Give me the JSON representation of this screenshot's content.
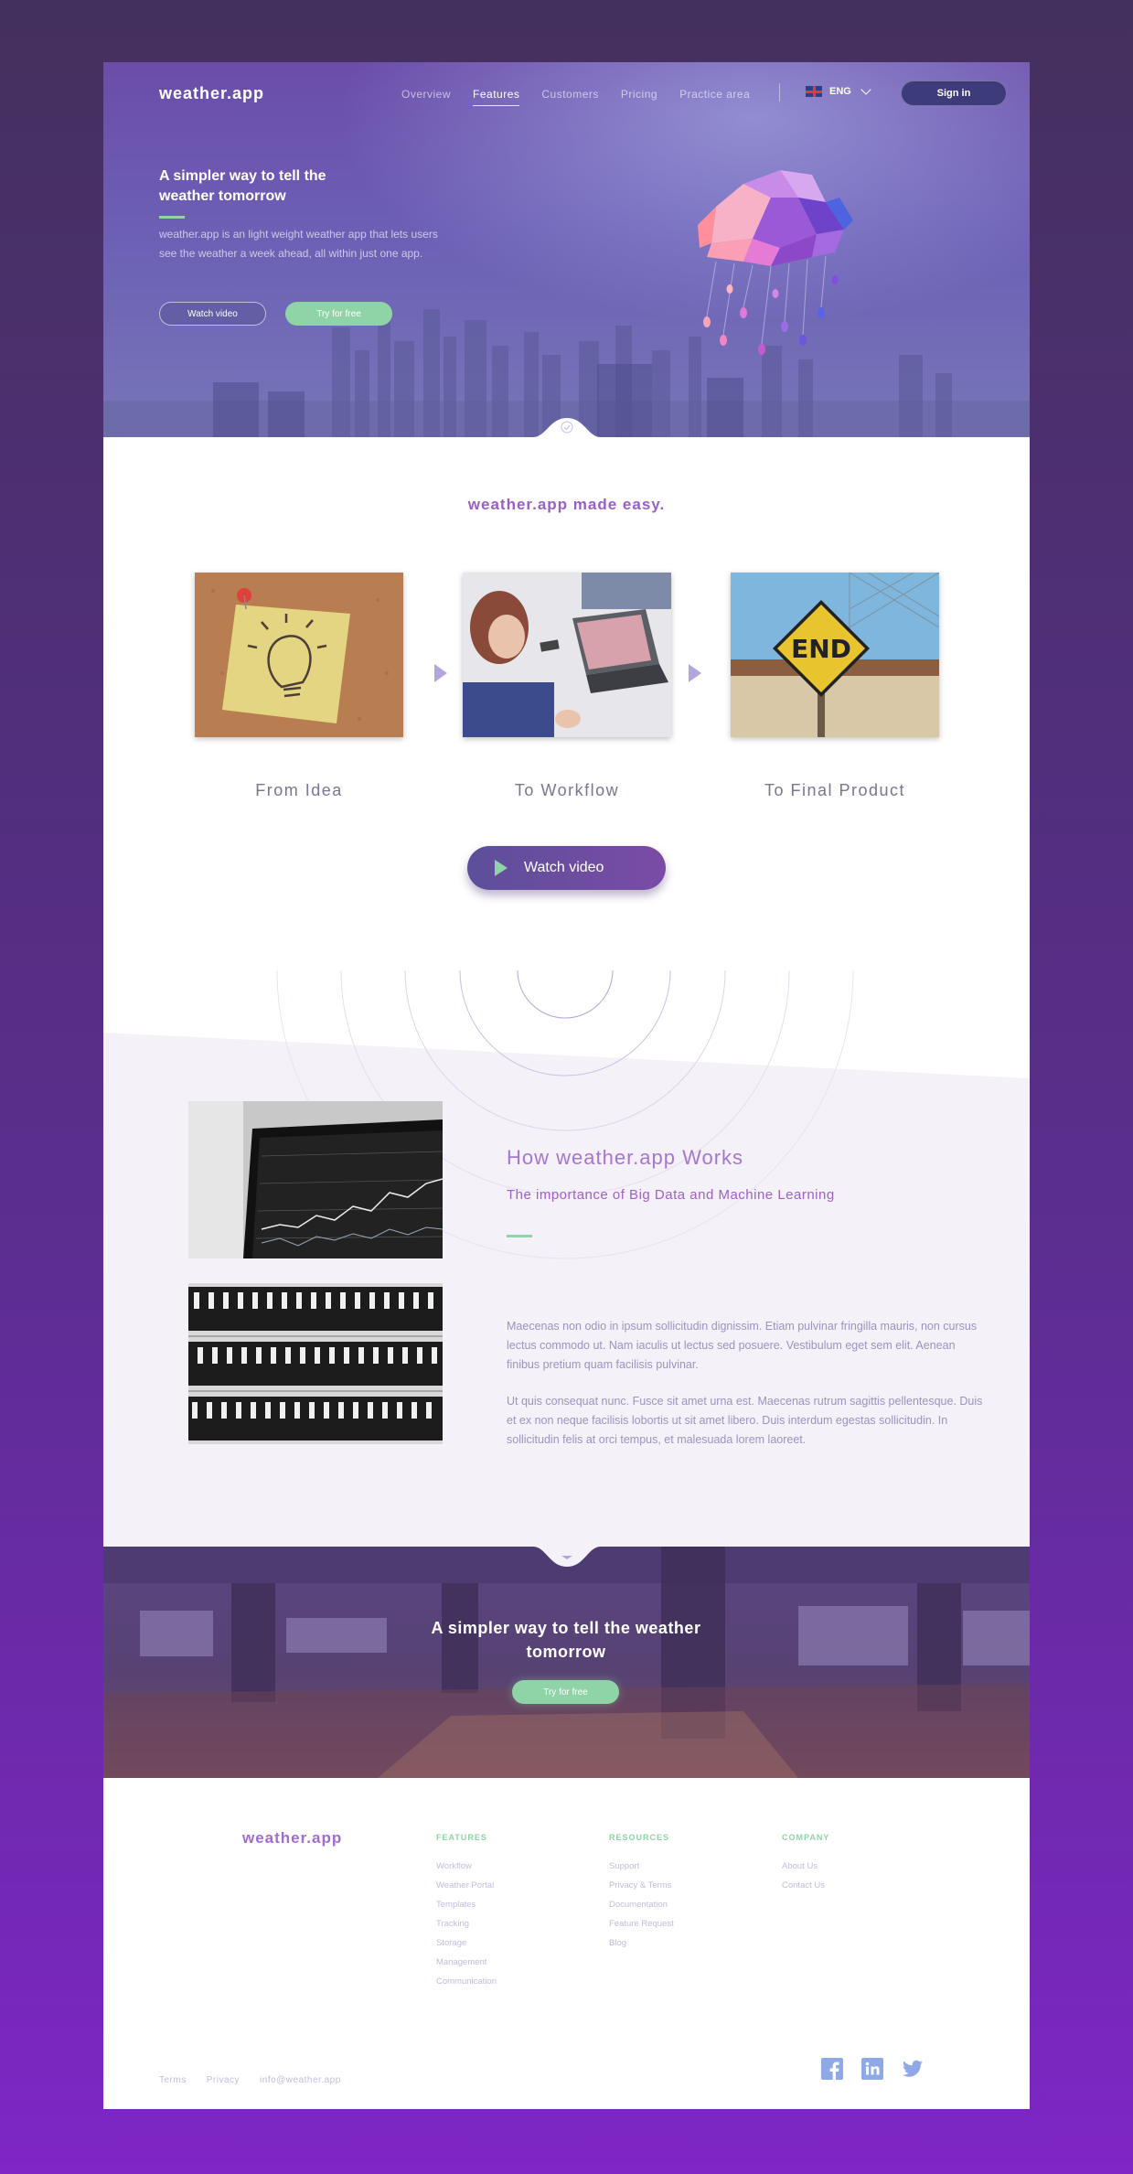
{
  "colors": {
    "accent_green": "#8fd4a6",
    "brand_purple": "#9a5fc6",
    "hero_purple": "#6b4da9",
    "signin_bg": "#3e3b7a"
  },
  "nav": {
    "logo": "weather.app",
    "links": [
      "Overview",
      "Features",
      "Customers",
      "Pricing",
      "Practice area"
    ],
    "active": "Features",
    "language": "ENG",
    "signin": "Sign in"
  },
  "hero": {
    "title": "A simpler way to tell the weather tomorrow",
    "description": "weather.app is an light weight weather app that lets users see the weather a week ahead, all within just one app.",
    "watch_button": "Watch video",
    "try_button": "Try for free"
  },
  "easy": {
    "title": "weather.app made easy.",
    "steps": [
      "From Idea",
      "To Workflow",
      "To Final Product"
    ],
    "sign_text": "END",
    "watch_button": "Watch video"
  },
  "works": {
    "title": "How weather.app Works",
    "subtitle": "The importance of Big Data and Machine Learning",
    "paragraph1": "Maecenas non odio in ipsum sollicitudin dignissim. Etiam pulvinar fringilla mauris, non cursus lectus commodo ut. Nam iaculis ut lectus sed posuere. Vestibulum eget sem elit. Aenean finibus pretium quam facilisis pulvinar.",
    "paragraph2": "Ut quis consequat nunc. Fusce sit amet urna est. Maecenas rutrum sagittis pellentesque. Duis et ex non neque facilisis lobortis ut sit amet libero. Duis interdum egestas sollicitudin. In sollicitudin felis at orci tempus, et malesuada lorem laoreet."
  },
  "cta": {
    "title": "A simpler way to tell the weather tomorrow",
    "try_button": "Try for free"
  },
  "footer": {
    "logo": "weather.app",
    "features": {
      "heading": "FEATURES",
      "links": [
        "Workflow",
        "Weather Portal",
        "Templates",
        "Tracking",
        "Storage",
        "Management",
        "Communication"
      ]
    },
    "resources": {
      "heading": "RESOURCES",
      "links": [
        "Support",
        "Privacy & Terms",
        "Documentation",
        "Feature Request",
        "Blog"
      ]
    },
    "company": {
      "heading": "COMPANY",
      "links": [
        "About Us",
        "Contact Us"
      ]
    },
    "bottom_links": [
      "Terms",
      "Privacy",
      "info@weather.app"
    ],
    "social": [
      "facebook-icon",
      "linkedin-icon",
      "twitter-icon"
    ]
  }
}
